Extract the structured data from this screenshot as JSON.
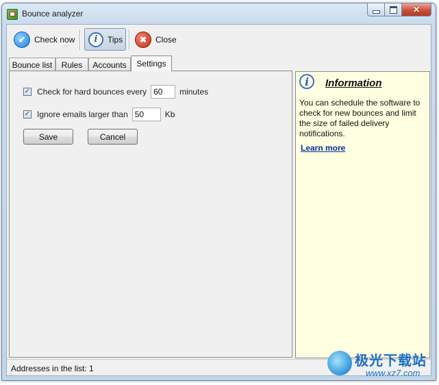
{
  "window": {
    "title": "Bounce analyzer",
    "close_glyph": "✕"
  },
  "toolbar": {
    "check_now": "Check now",
    "tips": "Tips",
    "close": "Close",
    "close_glyph": "✖",
    "check_glyph": "✔",
    "info_glyph": "i"
  },
  "tabs": [
    "Bounce list",
    "Rules",
    "Accounts",
    "Settings"
  ],
  "active_tab": "Settings",
  "settings": {
    "hard_bounce": {
      "label": "Check for hard bounces every",
      "value": "60",
      "unit": "minutes",
      "checked": true
    },
    "ignore_large": {
      "label": "Ignore emails larger than",
      "value": "50",
      "unit": "Kb",
      "checked": true
    },
    "check_mark": "✓",
    "save_label": "Save",
    "cancel_label": "Cancel"
  },
  "info": {
    "title": "Information",
    "icon_glyph": "i",
    "body": "You can schedule the software to check for new bounces and limit the size of failed delivery notifications.",
    "link": "Learn more"
  },
  "status": {
    "text": "Addresses in the list:  1"
  },
  "watermark": {
    "text": "极光下载站",
    "url": "www.xz7.com"
  },
  "colors": {
    "info_bg": "#ffffe1",
    "link": "#0b2ea0",
    "close_red": "#c92d14",
    "accent_blue": "#1f7fd8"
  }
}
